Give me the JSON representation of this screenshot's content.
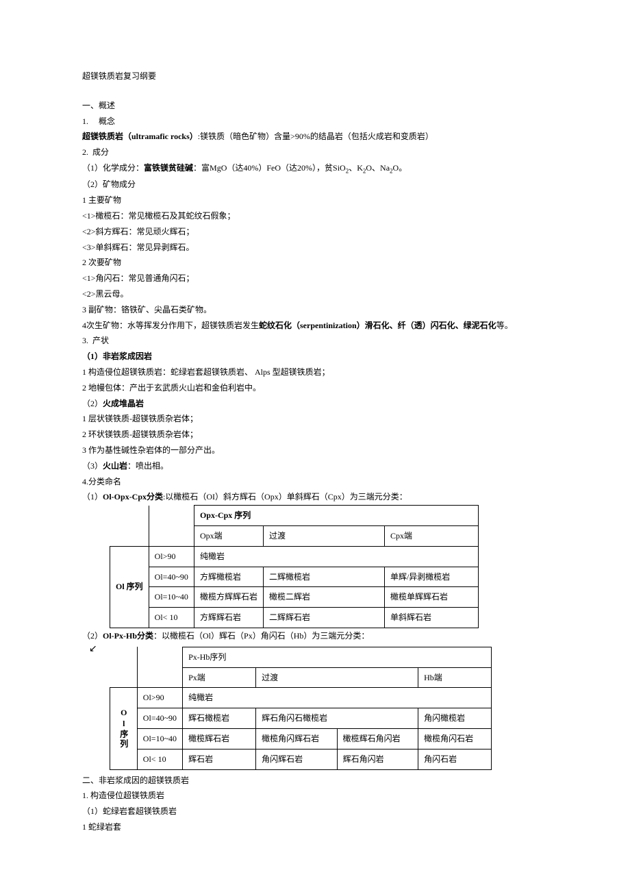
{
  "title": "超镁铁质岩复习纲要",
  "s1": {
    "heading": "一、概述",
    "i1": {
      "num": "1.",
      "label": "概念",
      "def_pre": "超镁铁质岩（ultramafic rocks）",
      "def_post": ":镁铁质（暗色矿物）含量>90%的结晶岩（包括火成岩和变质岩）"
    },
    "i2": {
      "num": "2.",
      "label": "成分",
      "chem_pre": "（1）化学成分：",
      "chem_bold": "富铁镁贫硅碱",
      "chem_post_a": "：富MgO（达40%）FeO（达20%），贫SiO",
      "chem_post_b": "、K",
      "chem_post_c": "O、Na",
      "chem_post_d": "O。",
      "min_hdr": "（2）矿物成分",
      "main_hdr": "1 主要矿物",
      "m1": "<1>橄榄石：常见橄榄石及其蛇纹石假象；",
      "m2": "<2>斜方辉石：常见顽火辉石；",
      "m3": "<3>单斜辉石：常见异剥辉石。",
      "sec_hdr": "2 次要矿物",
      "s1": "<1>角闪石：常见普通角闪石；",
      "s2": "<2>黑云母。",
      "acc": "3 副矿物：铬铁矿、尖晶石类矿物。",
      "alt_pre": "4次生矿物：水等挥发分作用下，超镁铁质岩发生",
      "alt_bold": "蛇纹石化（serpentinization）滑石化、纤（透）闪石化、绿泥石化",
      "alt_post": "等。"
    },
    "i3": {
      "num": "3.",
      "label": "产状",
      "p1_bold": "（1）非岩浆成因岩",
      "p1a": "1 构造侵位超镁铁质岩：蛇绿岩套超镁铁质岩、 Alps 型超镁铁质岩；",
      "p1b": "2 地幔包体：产出于玄武质火山岩和金伯利岩中。",
      "p2_pre": "（2）",
      "p2_bold": "火成堆晶岩",
      "p2a": "1 层状镁铁质-超镁铁质杂岩体；",
      "p2b": "2 环状镁铁质-超镁铁质杂岩体；",
      "p2c": "3 作为基性碱性杂岩体的一部分产出。",
      "p3_pre": "（3）",
      "p3_bold": "火山岩",
      "p3_post": "：喷出相。"
    },
    "i4": {
      "num": "4.",
      "label": "分类命名",
      "t1_pre": "（1）",
      "t1_bold": "Ol-Opx-Cpx分类",
      "t1_post": ":以橄榄石（OI）斜方辉石（Opx）单斜辉石（Cpx）为三端元分类：",
      "t2_pre": "（2）",
      "t2_bold": "Ol-Px-Hb分类",
      "t2_post": "：以橄榄石（Ol）辉石（Px）角闪石（Hb）为三端元分类："
    }
  },
  "table1": {
    "col_hdr": "Opx-Cpx 序列",
    "c1": "Opx端",
    "c2": "过渡",
    "c3": "Cpx端",
    "row_hdr": "Ol 序列",
    "r1l": "Ol>90",
    "r1v": "纯橄岩",
    "r2l": "Ol=40~90",
    "r2a": "方辉橄榄岩",
    "r2b": "二辉橄榄岩",
    "r2c": "单辉/异剥橄榄岩",
    "r3l": "Ol=10~40",
    "r3a": "橄榄方辉辉石岩",
    "r3b": "橄榄二辉岩",
    "r3c": "橄榄单辉辉石岩",
    "r4l": "Ol< 10",
    "r4a": "方辉辉石岩",
    "r4b": "二辉辉石岩",
    "r4c": "单斜辉石岩"
  },
  "table2": {
    "col_hdr": "Px-Hb序列",
    "c1": "Px端",
    "c2": "过渡",
    "c3": "Hb端",
    "row_hdr": "Ol序列",
    "r1l": "Ol>90",
    "r1v": "纯橄岩",
    "r2l": "Ol=40~90",
    "r2a": "辉石橄榄岩",
    "r2b": "辉石角闪石橄榄岩",
    "r2c": "角闪橄榄岩",
    "r3l": "Ol=10~40",
    "r3a": "橄榄辉石岩",
    "r3b": "橄榄角闪辉石岩",
    "r3c": "橄榄辉石角闪岩",
    "r3d": "橄榄角闪石岩",
    "r4l": "Ol< 10",
    "r4a": "辉石岩",
    "r4b": "角闪辉石岩",
    "r4c": "辉石角闪岩",
    "r4d": "角闪石岩"
  },
  "s2": {
    "heading": "二、非岩浆成因的超镁铁质岩",
    "i1": "1.    构造侵位超镁铁质岩",
    "i1a": "（1）蛇绿岩套超镁铁质岩",
    "i1a1": "1 蛇绿岩套"
  },
  "arrow": "↙"
}
